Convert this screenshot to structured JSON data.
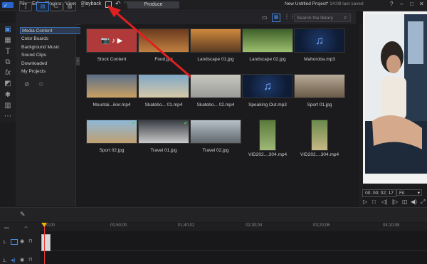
{
  "menubar": {
    "items": [
      "File",
      "Edit",
      "Plugins",
      "View",
      "Playback"
    ],
    "produce_label": "Produce",
    "project_title": "New Untitled Project*",
    "project_status": " 14:08 last saved"
  },
  "library": {
    "search_placeholder": "Search the library",
    "categories": [
      "Media Content",
      "Color Boards",
      "Background Music",
      "Sound Clips",
      "Downloaded",
      "My Projects"
    ],
    "tiles": [
      {
        "label": "Stock Content",
        "kind": "stock"
      },
      {
        "label": "Food.jpg",
        "kind": "photo",
        "colors": [
          "#6b3b1e",
          "#c08040"
        ]
      },
      {
        "label": "Landscape 01.jpg",
        "kind": "photo",
        "colors": [
          "#d0893c",
          "#5a3b22"
        ]
      },
      {
        "label": "Landscape 02.jpg",
        "kind": "photo",
        "colors": [
          "#3f5f2a",
          "#9cc070"
        ]
      },
      {
        "label": "Mahoroba.mp3",
        "kind": "audio"
      },
      {
        "label": "Mountai...iker.mp4",
        "kind": "photo",
        "colors": [
          "#5a6f8a",
          "#caa060"
        ]
      },
      {
        "label": "Skatebo... 01.mp4",
        "kind": "photo",
        "colors": [
          "#7fa8c8",
          "#d8c8a8"
        ]
      },
      {
        "label": "Skatebo... 02.mp4",
        "kind": "photo",
        "colors": [
          "#c8c8c0",
          "#9a9a98"
        ]
      },
      {
        "label": "Speaking Out.mp3",
        "kind": "audio"
      },
      {
        "label": "Sport 01.jpg",
        "kind": "photo",
        "colors": [
          "#b8aa98",
          "#6a5a48"
        ]
      },
      {
        "label": "Sport 02.jpg",
        "kind": "photo",
        "colors": [
          "#8fb8d8",
          "#c0a070"
        ],
        "check": true
      },
      {
        "label": "Travel 01.jpg",
        "kind": "photo",
        "colors": [
          "#3a3e44",
          "#c8c8c8"
        ],
        "check": true
      },
      {
        "label": "Travel 02.jpg",
        "kind": "photo",
        "colors": [
          "#b8c0c8",
          "#60686e"
        ]
      },
      {
        "label": "VID202....304.mp4",
        "kind": "portrait",
        "colors": [
          "#5a7a3a",
          "#a0b878"
        ]
      },
      {
        "label": "VID202....304.mp4",
        "kind": "portrait",
        "colors": [
          "#6a8a4a",
          "#c8b888"
        ]
      }
    ]
  },
  "preview": {
    "timecode": "00; 00; 02; 17",
    "fit": "Fit"
  },
  "timeline": {
    "ticks": [
      "00;00",
      "00;50;00",
      "01;40;02",
      "02;30;04",
      "03;20;06",
      "04;10;08"
    ],
    "tracks": [
      "1.",
      "1."
    ]
  },
  "colors": {
    "accent": "#3a7bd5",
    "arrow": "#e02020",
    "playhead": "#e53935"
  }
}
